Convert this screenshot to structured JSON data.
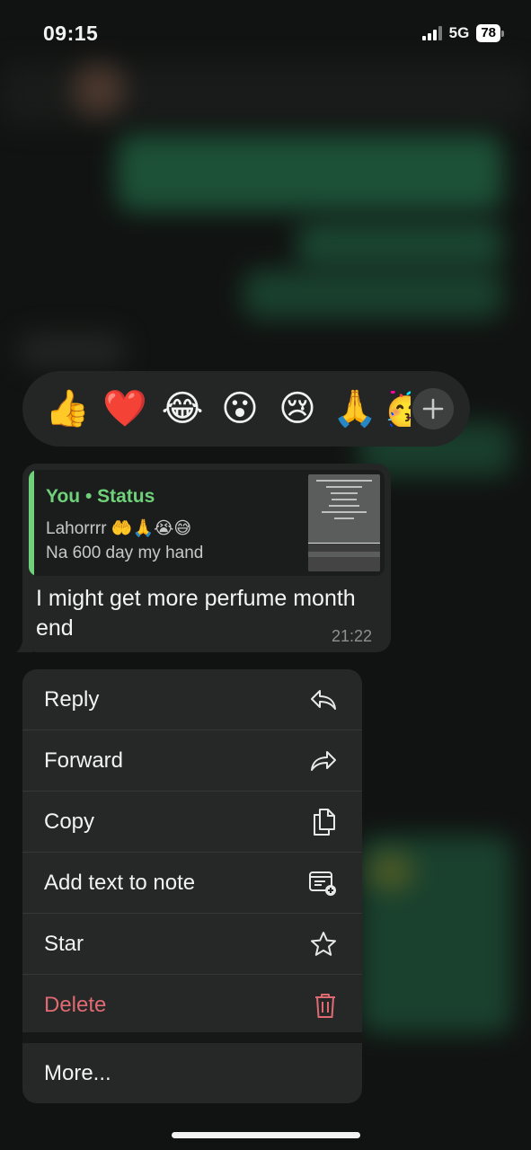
{
  "status_bar": {
    "time": "09:15",
    "network": "5G",
    "battery": "78"
  },
  "reactions": {
    "emojis": [
      "👍",
      "❤️",
      "😂",
      "😮",
      "😢",
      "🙏",
      "🥳"
    ],
    "more_icon": "plus-icon"
  },
  "message": {
    "quote": {
      "title": "You • Status",
      "line1": "Lahorrrr 🤲🙏😭😅",
      "line2": "Na 600 day my hand"
    },
    "text": "I might get more perfume month end",
    "time": "21:22"
  },
  "menu": {
    "items": [
      {
        "label": "Reply",
        "icon": "reply-icon"
      },
      {
        "label": "Forward",
        "icon": "forward-icon"
      },
      {
        "label": "Copy",
        "icon": "copy-icon"
      },
      {
        "label": "Add text to note",
        "icon": "note-icon"
      },
      {
        "label": "Star",
        "icon": "star-icon"
      },
      {
        "label": "Delete",
        "icon": "trash-icon"
      }
    ],
    "more_label": "More..."
  },
  "colors": {
    "accent_green": "#6fd27a",
    "danger": "#e06a72",
    "bubble": "#232625"
  }
}
